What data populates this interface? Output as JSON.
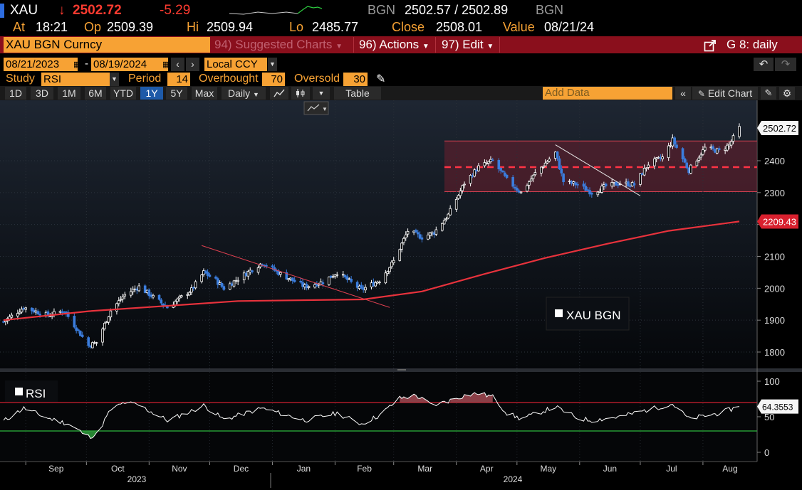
{
  "header": {
    "ticker": "XAU",
    "arrow": "↓",
    "price": "2502.72",
    "change": "-5.29",
    "source": "BGN",
    "bid_ask": "2502.57 / 2502.89",
    "source2": "BGN",
    "at_label": "At",
    "at_value": "18:21",
    "op_label": "Op",
    "op_value": "2509.39",
    "hi_label": "Hi",
    "hi_value": "2509.94",
    "lo_label": "Lo",
    "lo_value": "2485.77",
    "close_label": "Close",
    "close_value": "2508.01",
    "value_label": "Value",
    "value_value": "08/21/24"
  },
  "menu": {
    "security": "XAU BGN Curncy",
    "suggested": "94) Suggested Charts",
    "actions": "96) Actions",
    "edit": "97) Edit",
    "graph": "G 8: daily"
  },
  "controls": {
    "start_date": "08/21/2023",
    "end_date": "08/19/2024",
    "dash": "-",
    "currency": "Local CCY",
    "study_label": "Study",
    "study_value": "RSI",
    "period_label": "Period",
    "period_value": "14",
    "overbought_label": "Overbought",
    "overbought_value": "70",
    "oversold_label": "Oversold",
    "oversold_value": "30"
  },
  "toolbar": {
    "ranges": [
      "1D",
      "3D",
      "1M",
      "6M",
      "YTD",
      "1Y",
      "5Y",
      "Max"
    ],
    "selected_range": "1Y",
    "frequency": "Daily",
    "table": "Table",
    "add_data_placeholder": "Add Data",
    "edit_chart": "Edit Chart"
  },
  "colors": {
    "orange": "#f7a234",
    "red_bar": "#8a0f1c",
    "up_candle": "#ffffff",
    "down_candle": "#3b7ddd",
    "moving_average": "#e8323c",
    "range_band": "#6b1f2e",
    "rsi_line": "#ffffff",
    "overbought_line": "#d02030",
    "oversold_line": "#2db83d"
  },
  "chart_data": {
    "type": "candlestick",
    "price_axis": {
      "ticks": [
        1800,
        1900,
        2000,
        2100,
        2200,
        2300,
        2400
      ],
      "range": [
        1760,
        2540
      ]
    },
    "last_price_label": "2502.72",
    "ma_label": "2209.43",
    "legend": "XAU BGN",
    "months": [
      "Sep",
      "Oct",
      "Nov",
      "Dec",
      "Jan",
      "Feb",
      "Mar",
      "Apr",
      "May",
      "Jun",
      "Jul",
      "Aug"
    ],
    "years": [
      "2023",
      "2024"
    ],
    "range_band": {
      "low": 2303,
      "mid": 2380,
      "high": 2462
    },
    "trendlines": [
      {
        "from": [
          "2023-11-27",
          2134
        ],
        "to": [
          "2024-02-28",
          1940
        ]
      },
      {
        "from": [
          "2024-05-20",
          2450
        ],
        "to": [
          "2024-07-01",
          2290
        ]
      }
    ],
    "close_keypoints": [
      [
        "2023-08-21",
        1895
      ],
      [
        "2023-08-31",
        1940
      ],
      [
        "2023-09-12",
        1915
      ],
      [
        "2023-09-20",
        1930
      ],
      [
        "2023-10-02",
        1820
      ],
      [
        "2023-10-06",
        1830
      ],
      [
        "2023-10-13",
        1930
      ],
      [
        "2023-10-20",
        1980
      ],
      [
        "2023-10-27",
        2005
      ],
      [
        "2023-11-10",
        1940
      ],
      [
        "2023-11-22",
        1995
      ],
      [
        "2023-11-28",
        2050
      ],
      [
        "2023-12-04",
        2025
      ],
      [
        "2023-12-08",
        2000
      ],
      [
        "2023-12-15",
        2030
      ],
      [
        "2023-12-27",
        2080
      ],
      [
        "2024-01-05",
        2045
      ],
      [
        "2024-01-17",
        2005
      ],
      [
        "2024-01-26",
        2020
      ],
      [
        "2024-02-02",
        2050
      ],
      [
        "2024-02-14",
        1995
      ],
      [
        "2024-02-23",
        2025
      ],
      [
        "2024-03-01",
        2085
      ],
      [
        "2024-03-08",
        2180
      ],
      [
        "2024-03-15",
        2160
      ],
      [
        "2024-03-21",
        2175
      ],
      [
        "2024-03-28",
        2230
      ],
      [
        "2024-04-05",
        2330
      ],
      [
        "2024-04-12",
        2380
      ],
      [
        "2024-04-19",
        2400
      ],
      [
        "2024-04-26",
        2340
      ],
      [
        "2024-05-03",
        2300
      ],
      [
        "2024-05-10",
        2360
      ],
      [
        "2024-05-20",
        2425
      ],
      [
        "2024-05-24",
        2335
      ],
      [
        "2024-05-31",
        2325
      ],
      [
        "2024-06-07",
        2300
      ],
      [
        "2024-06-14",
        2320
      ],
      [
        "2024-06-21",
        2330
      ],
      [
        "2024-06-28",
        2325
      ],
      [
        "2024-07-05",
        2390
      ],
      [
        "2024-07-12",
        2410
      ],
      [
        "2024-07-17",
        2465
      ],
      [
        "2024-07-25",
        2370
      ],
      [
        "2024-08-02",
        2440
      ],
      [
        "2024-08-09",
        2430
      ],
      [
        "2024-08-14",
        2450
      ],
      [
        "2024-08-19",
        2503
      ]
    ],
    "ma_keypoints": [
      [
        "2023-08-21",
        1900
      ],
      [
        "2023-10-02",
        1928
      ],
      [
        "2023-12-15",
        1960
      ],
      [
        "2024-02-15",
        1965
      ],
      [
        "2024-03-15",
        1990
      ],
      [
        "2024-04-15",
        2045
      ],
      [
        "2024-05-15",
        2095
      ],
      [
        "2024-06-15",
        2140
      ],
      [
        "2024-07-15",
        2180
      ],
      [
        "2024-08-19",
        2209.43
      ]
    ],
    "rsi": {
      "label": "RSI",
      "axis_ticks": [
        0,
        50,
        100
      ],
      "overbought": 70,
      "oversold": 30,
      "last_value_label": "64.3553",
      "keypoints": [
        [
          "2023-08-21",
          44
        ],
        [
          "2023-08-31",
          62
        ],
        [
          "2023-09-12",
          48
        ],
        [
          "2023-09-22",
          40
        ],
        [
          "2023-10-02",
          22
        ],
        [
          "2023-10-06",
          25
        ],
        [
          "2023-10-13",
          60
        ],
        [
          "2023-10-20",
          70
        ],
        [
          "2023-10-27",
          66
        ],
        [
          "2023-11-10",
          45
        ],
        [
          "2023-11-22",
          58
        ],
        [
          "2023-11-28",
          66
        ],
        [
          "2023-12-08",
          46
        ],
        [
          "2023-12-27",
          62
        ],
        [
          "2024-01-17",
          45
        ],
        [
          "2024-02-02",
          55
        ],
        [
          "2024-02-14",
          40
        ],
        [
          "2024-02-23",
          52
        ],
        [
          "2024-03-04",
          76
        ],
        [
          "2024-03-12",
          80
        ],
        [
          "2024-03-20",
          66
        ],
        [
          "2024-03-28",
          72
        ],
        [
          "2024-04-05",
          80
        ],
        [
          "2024-04-12",
          83
        ],
        [
          "2024-04-19",
          78
        ],
        [
          "2024-04-26",
          55
        ],
        [
          "2024-05-03",
          47
        ],
        [
          "2024-05-20",
          64
        ],
        [
          "2024-05-31",
          48
        ],
        [
          "2024-06-07",
          45
        ],
        [
          "2024-06-21",
          50
        ],
        [
          "2024-07-05",
          60
        ],
        [
          "2024-07-17",
          68
        ],
        [
          "2024-07-25",
          47
        ],
        [
          "2024-08-09",
          55
        ],
        [
          "2024-08-19",
          64.3553
        ]
      ]
    }
  }
}
